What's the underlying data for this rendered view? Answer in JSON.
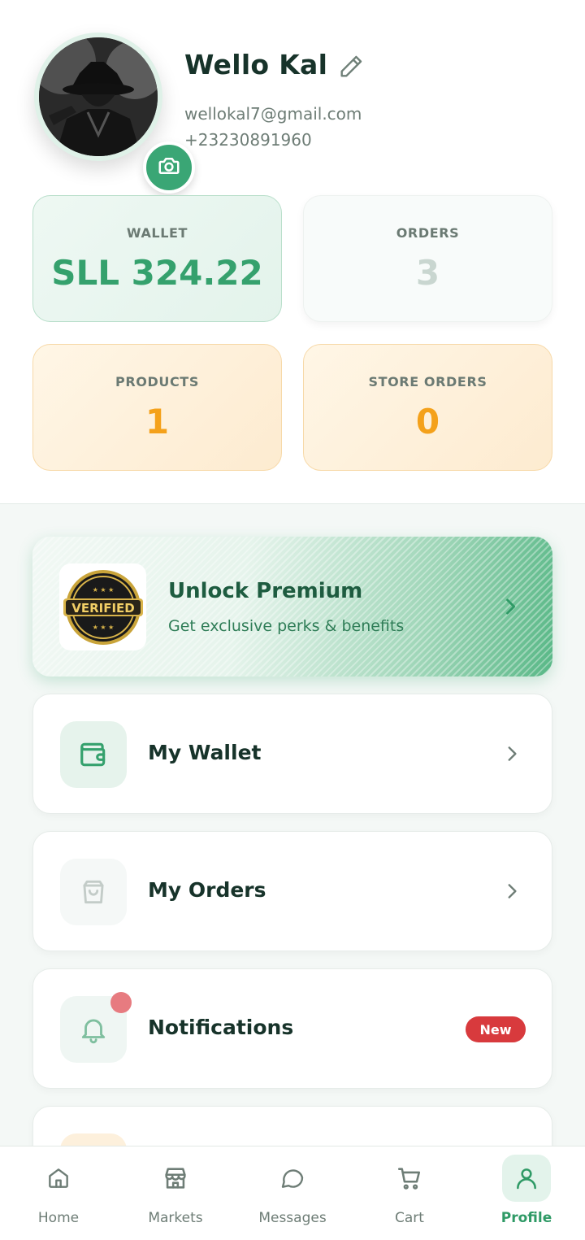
{
  "profile": {
    "name": "Wello Kal",
    "email": "wellokal7@gmail.com",
    "phone": "+23230891960"
  },
  "stats": {
    "wallet": {
      "label": "WALLET",
      "value": "SLL 324.22"
    },
    "orders": {
      "label": "ORDERS",
      "value": "3"
    },
    "products": {
      "label": "PRODUCTS",
      "value": "1"
    },
    "store_orders": {
      "label": "STORE ORDERS",
      "value": "0"
    }
  },
  "premium": {
    "badge_text": "VERIFIED",
    "title": "Unlock Premium",
    "subtitle": "Get exclusive perks & benefits"
  },
  "menu": [
    {
      "label": "My Wallet",
      "icon": "wallet-icon"
    },
    {
      "label": "My Orders",
      "icon": "shopping-bag-icon"
    },
    {
      "label": "Notifications",
      "icon": "bell-icon",
      "badge": "New"
    }
  ],
  "bottom_nav": [
    {
      "label": "Home",
      "icon": "home-icon"
    },
    {
      "label": "Markets",
      "icon": "store-icon"
    },
    {
      "label": "Messages",
      "icon": "chat-icon"
    },
    {
      "label": "Cart",
      "icon": "cart-icon"
    },
    {
      "label": "Profile",
      "icon": "user-icon",
      "active": true
    }
  ],
  "colors": {
    "accent": "#3aa675",
    "orange": "#f4a11b",
    "badge_red": "#d83a3d"
  }
}
